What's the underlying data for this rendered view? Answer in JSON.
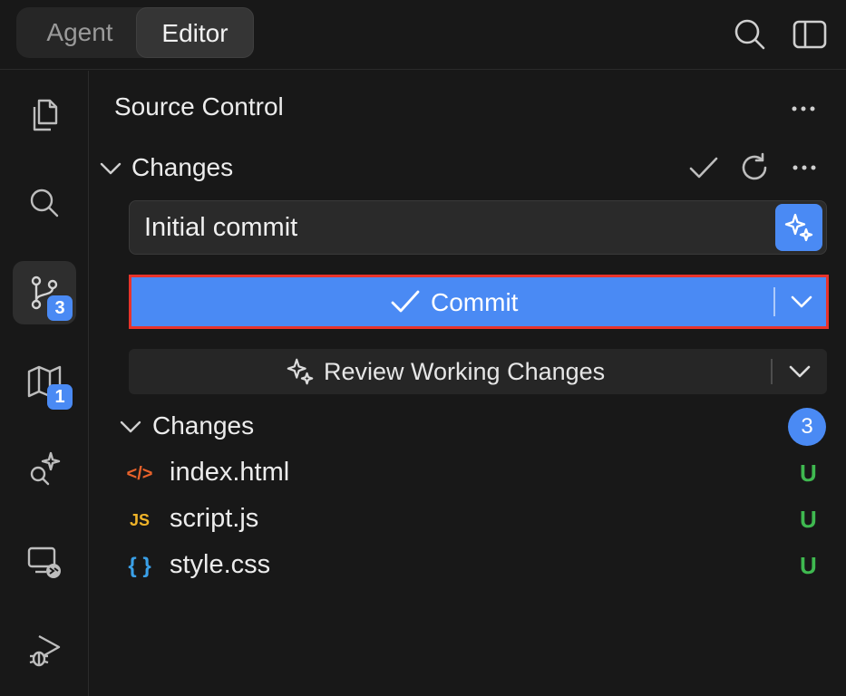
{
  "tabs": {
    "agent": "Agent",
    "editor": "Editor"
  },
  "activity_bar": {
    "source_control_badge": "3",
    "map_badge": "1"
  },
  "panel": {
    "title": "Source Control",
    "changes_section_label": "Changes",
    "commit_message_value": "Initial commit",
    "commit_label": "Commit",
    "review_label": "Review Working Changes",
    "changes_group_label": "Changes",
    "changes_count": "3",
    "files": [
      {
        "name": "index.html",
        "icon": "</>",
        "status": "U"
      },
      {
        "name": "script.js",
        "icon": "JS",
        "status": "U"
      },
      {
        "name": "style.css",
        "icon": "{ }",
        "status": "U"
      }
    ]
  },
  "colors": {
    "accent": "#4a8af4",
    "highlight_border": "#e8332b",
    "untracked": "#3fb950",
    "html_icon": "#e8622b",
    "js_icon": "#f0b429",
    "css_icon": "#3aa0e8"
  }
}
